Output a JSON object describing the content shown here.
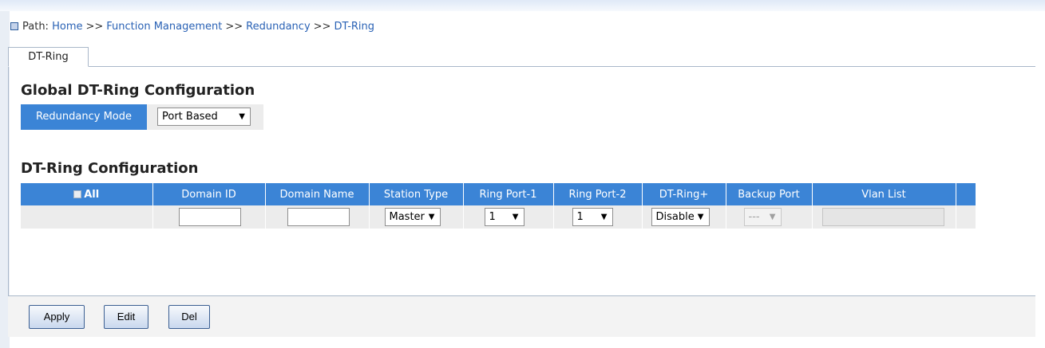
{
  "breadcrumb": {
    "prefix": "Path:",
    "items": [
      "Home",
      "Function Management",
      "Redundancy",
      "DT-Ring"
    ],
    "separator": ">>"
  },
  "tabs": [
    {
      "label": "DT-Ring",
      "active": true
    }
  ],
  "global_section": {
    "title": "Global DT-Ring Configuration",
    "mode_label": "Redundancy Mode",
    "mode_value": "Port Based"
  },
  "ring_section": {
    "title": "DT-Ring Configuration",
    "headers": [
      "All",
      "Domain ID",
      "Domain Name",
      "Station Type",
      "Ring Port-1",
      "Ring Port-2",
      "DT-Ring+",
      "Backup Port",
      "Vlan List"
    ],
    "row": {
      "domain_id": "",
      "domain_name": "",
      "station_type": "Master",
      "ring_port_1": "1",
      "ring_port_2": "1",
      "dt_ring_plus": "Disable",
      "backup_port": "---",
      "vlan_list": ""
    }
  },
  "buttons": {
    "apply": "Apply",
    "edit": "Edit",
    "del": "Del"
  },
  "colors": {
    "header_blue": "#3b84d6",
    "link_blue": "#2a62b5",
    "row_gray": "#ececec"
  }
}
